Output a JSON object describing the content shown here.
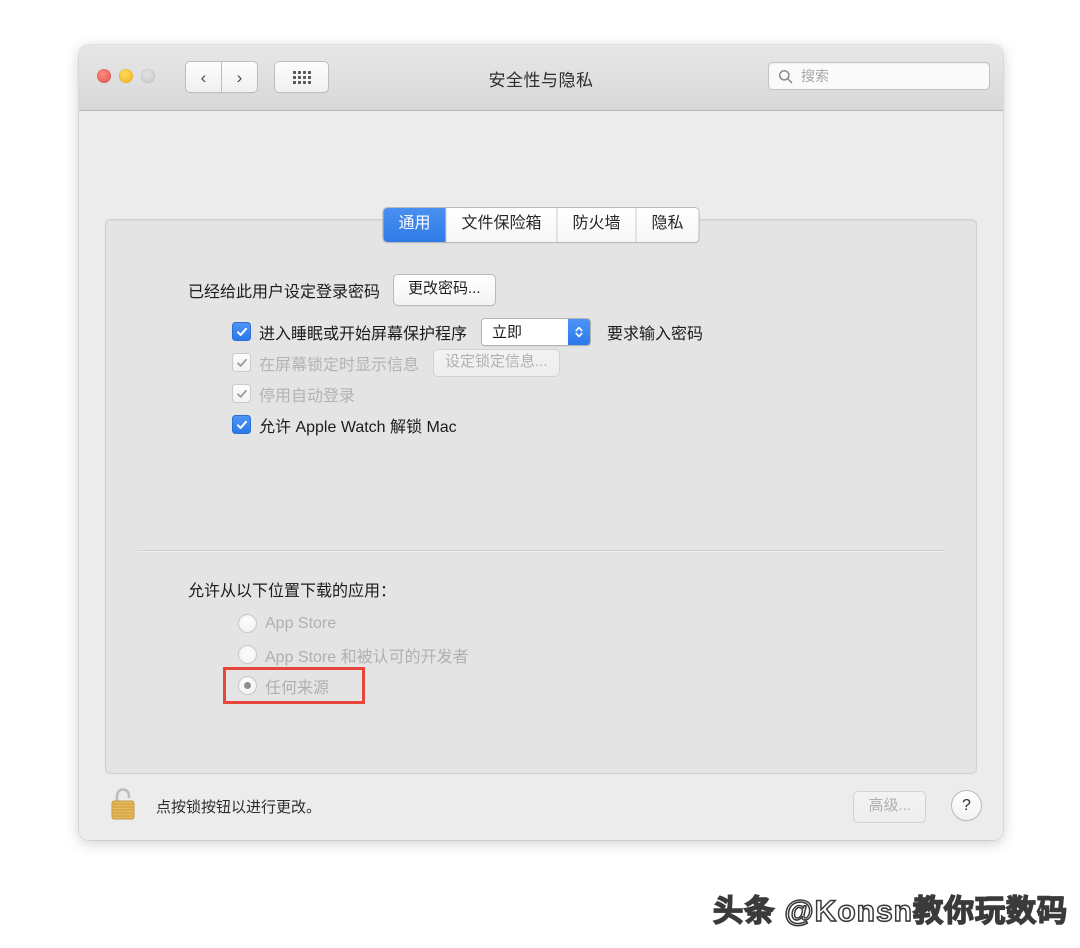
{
  "window": {
    "title": "安全性与隐私",
    "traffic_lights": [
      "close",
      "minimize",
      "zoom"
    ],
    "nav": {
      "back": "‹",
      "forward": "›"
    },
    "grid_button": "show-all-grid",
    "search": {
      "placeholder": "搜索",
      "value": "",
      "icon": "search-icon"
    }
  },
  "tabs": [
    {
      "label": "通用",
      "active": true
    },
    {
      "label": "文件保险箱",
      "active": false
    },
    {
      "label": "防火墙",
      "active": false
    },
    {
      "label": "隐私",
      "active": false
    }
  ],
  "general": {
    "password_status": "已经给此用户设定登录密码",
    "change_password_button": "更改密码...",
    "checkboxes": [
      {
        "label": "进入睡眠或开始屏幕保护程序",
        "checked": true,
        "disabled": false,
        "popup_value": "立即",
        "suffix": "要求输入密码"
      },
      {
        "label": "在屏幕锁定时显示信息",
        "checked": true,
        "disabled": true,
        "button": "设定锁定信息..."
      },
      {
        "label": "停用自动登录",
        "checked": true,
        "disabled": true
      },
      {
        "label": "允许 Apple Watch 解锁 Mac",
        "checked": true,
        "disabled": false
      }
    ],
    "download_section": {
      "title": "允许从以下位置下载的应用：",
      "options": [
        {
          "label": "App Store",
          "selected": false,
          "disabled": true,
          "highlighted": false
        },
        {
          "label": "App Store 和被认可的开发者",
          "selected": false,
          "disabled": true,
          "highlighted": false
        },
        {
          "label": "任何来源",
          "selected": true,
          "disabled": true,
          "highlighted": true
        }
      ],
      "highlight_color": "#e8453c"
    }
  },
  "bottom_bar": {
    "lock_icon": "unlocked-padlock-icon",
    "hint": "点按锁按钮以进行更改。",
    "advanced_button": "高级...",
    "advanced_disabled": true,
    "help_button": "?"
  },
  "watermark": "头条 @Konsn教你玩数码"
}
